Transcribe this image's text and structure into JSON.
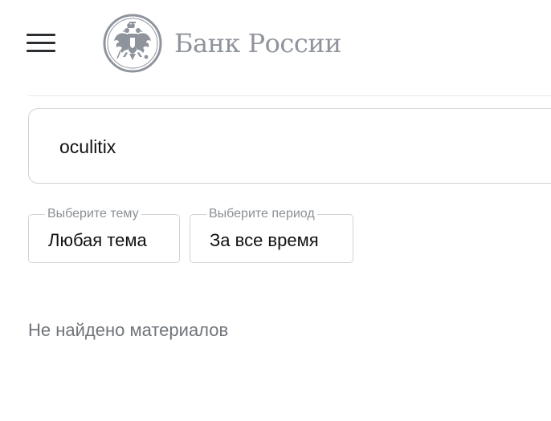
{
  "header": {
    "menu_icon": "hamburger-menu-icon",
    "logo_emblem": "double-headed-eagle-emblem",
    "logo_text": "Банк России"
  },
  "search": {
    "value": "oculitix",
    "icon": "none"
  },
  "filters": {
    "topic": {
      "legend": "Выберите тему",
      "value": "Любая тема"
    },
    "period": {
      "legend": "Выберите период",
      "value": "За все время"
    }
  },
  "results": {
    "empty_message": "Не найдено материалов"
  },
  "colors": {
    "logo_gray": "#8f949c",
    "border": "#cfd3d7",
    "muted_text": "#6f757b"
  }
}
